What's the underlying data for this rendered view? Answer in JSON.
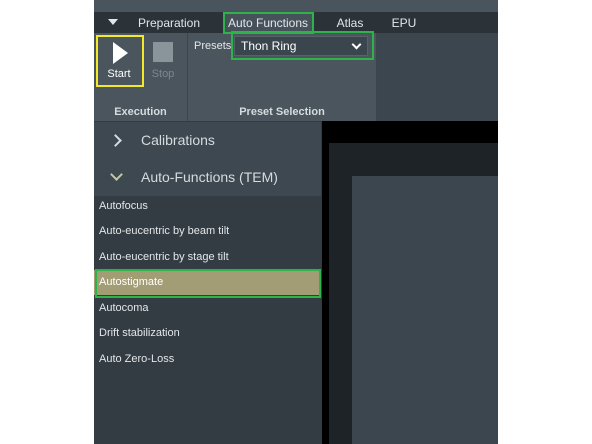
{
  "tabs": [
    {
      "label": "Preparation",
      "active": false
    },
    {
      "label": "Auto Functions",
      "active": true
    },
    {
      "label": "Atlas",
      "active": false
    },
    {
      "label": "EPU",
      "active": false
    }
  ],
  "ribbon": {
    "start_label": "Start",
    "stop_label": "Stop",
    "presets_label": "Presets",
    "presets_value": "Thon Ring",
    "execution_group": "Execution",
    "preset_selection_group": "Preset Selection"
  },
  "sidebar": {
    "calibrations": "Calibrations",
    "auto_functions_tem": "Auto-Functions (TEM)",
    "items": [
      {
        "label": "Autofocus"
      },
      {
        "label": "Auto-eucentric by beam tilt"
      },
      {
        "label": "Auto-eucentric by stage tilt"
      },
      {
        "label": "Autostigmate",
        "selected": true
      },
      {
        "label": "Autocoma"
      },
      {
        "label": "Drift stabilization"
      },
      {
        "label": "Auto Zero-Loss"
      }
    ]
  },
  "colors": {
    "highlight_green": "#2db34a",
    "highlight_yellow": "#f2ea28",
    "selected_item": "#a29d74"
  },
  "icons": {
    "menu": "menu-dropdown-icon",
    "start": "play-icon",
    "stop": "stop-icon",
    "collapsed": "chevron-right-icon",
    "expanded": "chevron-down-icon"
  }
}
